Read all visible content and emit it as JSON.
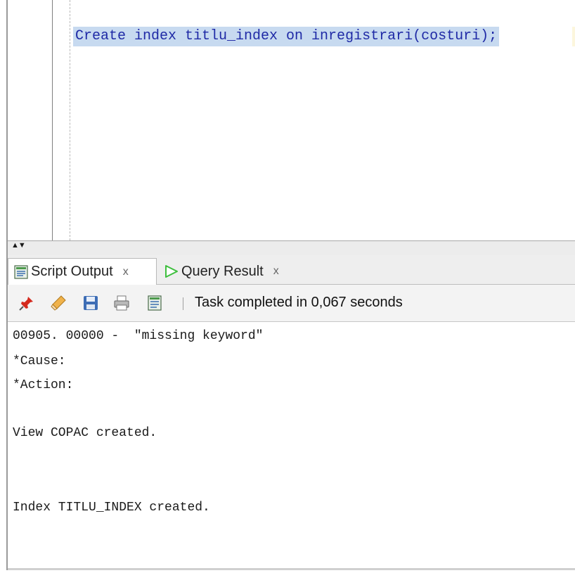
{
  "editor": {
    "code": "Create index titlu_index on inregistrari(costuri);"
  },
  "splitter": {
    "arrows": "▲▼"
  },
  "tabs": [
    {
      "label": "Script Output",
      "close": "x",
      "icon": "script-output-icon",
      "active": true
    },
    {
      "label": "Query Result",
      "close": "x",
      "icon": "query-result-icon",
      "active": false
    }
  ],
  "toolbar": {
    "buttons": [
      "pin-icon",
      "eraser-icon",
      "save-icon",
      "print-icon",
      "output-file-icon"
    ],
    "status": "Task completed in 0,067 seconds"
  },
  "output": {
    "lines": [
      "00905. 00000 -  \"missing keyword\"",
      "*Cause:",
      "*Action:",
      "",
      "View COPAC created.",
      "",
      "",
      "Index TITLU_INDEX created."
    ]
  },
  "colors": {
    "selection": "#c7daf0",
    "code_text": "#1f2aa6",
    "query_result_icon": "#3fbf3f"
  }
}
